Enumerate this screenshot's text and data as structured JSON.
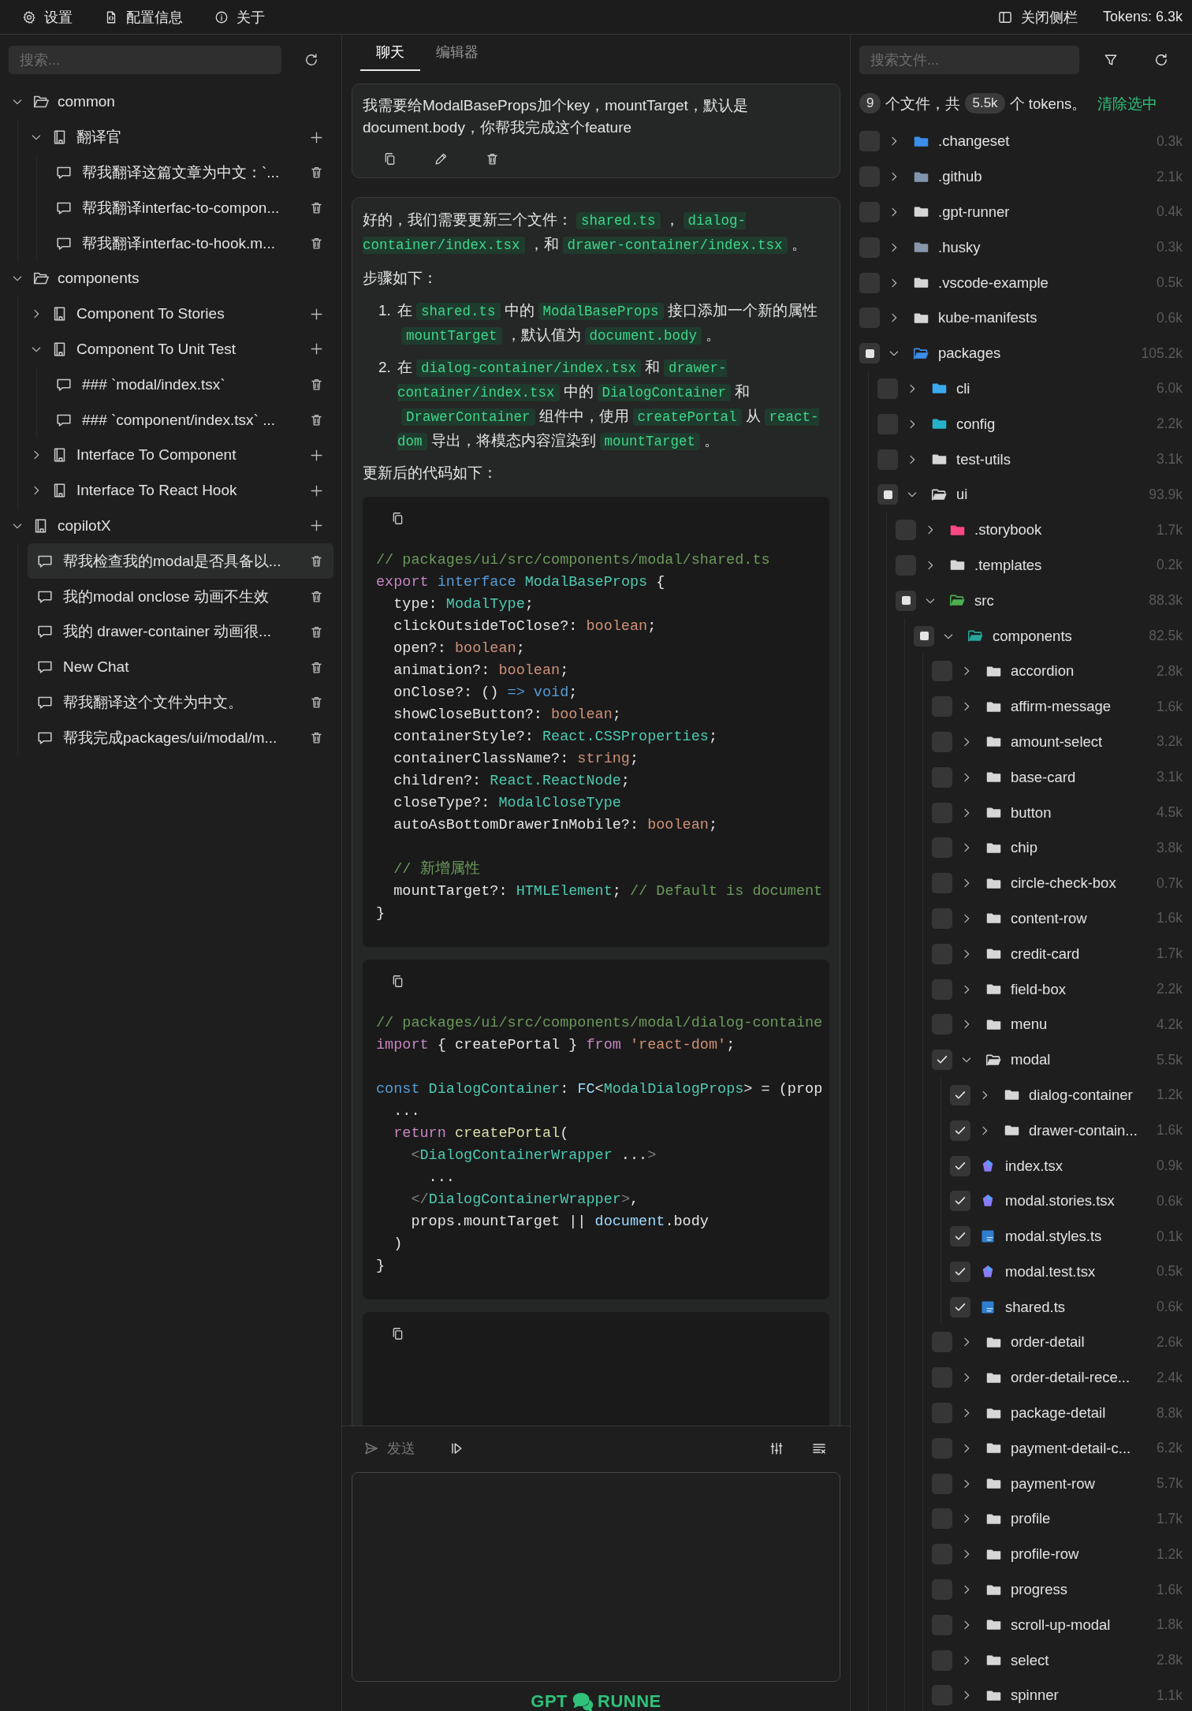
{
  "top_bar": {
    "items": [
      {
        "kind": "settings",
        "label": "设置"
      },
      {
        "kind": "config",
        "label": "配置信息"
      },
      {
        "kind": "about",
        "label": "关于"
      }
    ],
    "sidebar_toggle": "关闭侧栏",
    "tokens": "Tokens: 6.3k"
  },
  "sidebar": {
    "search": {
      "placeholder": "搜索..."
    },
    "tree": [
      {
        "kind": "folder",
        "label": "common",
        "expanded": true,
        "children": [
          {
            "kind": "prompt",
            "label": "翻译官",
            "expanded": true,
            "children": [
              {
                "kind": "chat",
                "label": "帮我翻译这篇文章为中文：`...",
                "selected": false
              },
              {
                "kind": "chat",
                "label": "帮我翻译interfac-to-compon...",
                "selected": false
              },
              {
                "kind": "chat",
                "label": "帮我翻译interfac-to-hook.m...",
                "selected": false
              }
            ]
          }
        ]
      },
      {
        "kind": "folder",
        "label": "components",
        "expanded": true,
        "children": [
          {
            "kind": "prompt",
            "label": "Component To Stories",
            "expanded": false
          },
          {
            "kind": "prompt",
            "label": "Component To Unit Test",
            "expanded": true,
            "children": [
              {
                "kind": "chat",
                "label": "### `modal/index.tsx`",
                "selected": false
              },
              {
                "kind": "chat",
                "label": "### `component/index.tsx` ...",
                "selected": false
              }
            ]
          },
          {
            "kind": "prompt",
            "label": "Interface To Component",
            "expanded": false
          },
          {
            "kind": "prompt",
            "label": "Interface To React Hook",
            "expanded": false
          }
        ]
      },
      {
        "kind": "prompt",
        "label": "copilotX",
        "expanded": true,
        "children": [
          {
            "kind": "chat",
            "label": "帮我检查我的modal是否具备以...",
            "selected": true
          },
          {
            "kind": "chat",
            "label": "我的modal onclose 动画不生效",
            "selected": false
          },
          {
            "kind": "chat",
            "label": "我的 drawer-container 动画很...",
            "selected": false
          },
          {
            "kind": "chat",
            "label": "New Chat",
            "selected": false
          },
          {
            "kind": "chat",
            "label": "帮我翻译这个文件为中文。",
            "selected": false
          },
          {
            "kind": "chat",
            "label": "帮我完成packages/ui/modal/m...",
            "selected": false
          }
        ]
      }
    ]
  },
  "chat": {
    "tabs": [
      {
        "label": "聊天",
        "selected": true
      },
      {
        "label": "编辑器",
        "selected": false
      }
    ],
    "messages": [
      {
        "kind": "user",
        "text": "我需要给ModalBaseProps加个key，mountTarget，默认是document.body，你帮我完成这个feature"
      },
      {
        "kind": "assistant",
        "blocks": [
          {
            "kind": "paragraph",
            "segments": [
              {
                "kind": "text",
                "text": "好的，我们需要更新三个文件："
              },
              {
                "kind": "code",
                "text": "shared.ts"
              },
              {
                "kind": "text",
                "text": "，"
              },
              {
                "kind": "code",
                "text": "dialog-container/index.tsx"
              },
              {
                "kind": "text",
                "text": "，和"
              },
              {
                "kind": "code",
                "text": "drawer-container/index.tsx"
              },
              {
                "kind": "text",
                "text": "。"
              }
            ]
          },
          {
            "kind": "paragraph",
            "segments": [
              {
                "kind": "text",
                "text": "步骤如下："
              }
            ]
          },
          {
            "kind": "list",
            "items": [
              {
                "number": "1.",
                "segments": [
                  {
                    "kind": "text",
                    "text": "在"
                  },
                  {
                    "kind": "code",
                    "text": "shared.ts"
                  },
                  {
                    "kind": "text",
                    "text": "中的"
                  },
                  {
                    "kind": "code",
                    "text": "ModalBaseProps"
                  },
                  {
                    "kind": "text",
                    "text": "接口添加一个新的属性"
                  },
                  {
                    "kind": "code",
                    "text": "mountTarget"
                  },
                  {
                    "kind": "text",
                    "text": "，默认值为"
                  },
                  {
                    "kind": "code",
                    "text": "document.body"
                  },
                  {
                    "kind": "text",
                    "text": "。"
                  }
                ]
              },
              {
                "number": "2.",
                "segments": [
                  {
                    "kind": "text",
                    "text": "在"
                  },
                  {
                    "kind": "code",
                    "text": "dialog-container/index.tsx"
                  },
                  {
                    "kind": "text",
                    "text": "和"
                  },
                  {
                    "kind": "code",
                    "text": "drawer-container/index.tsx"
                  },
                  {
                    "kind": "text",
                    "text": "中的"
                  },
                  {
                    "kind": "code",
                    "text": "DialogContainer"
                  },
                  {
                    "kind": "text",
                    "text": "和"
                  },
                  {
                    "kind": "code",
                    "text": "DrawerContainer"
                  },
                  {
                    "kind": "text",
                    "text": "组件中，使用"
                  },
                  {
                    "kind": "code",
                    "text": "createPortal"
                  },
                  {
                    "kind": "text",
                    "text": "从"
                  },
                  {
                    "kind": "code",
                    "text": "react-dom"
                  },
                  {
                    "kind": "text",
                    "text": "导出，将模态内容渲染到"
                  },
                  {
                    "kind": "code",
                    "text": "mountTarget"
                  },
                  {
                    "kind": "text",
                    "text": "。"
                  }
                ]
              }
            ]
          },
          {
            "kind": "paragraph",
            "segments": [
              {
                "kind": "text",
                "text": "更新后的代码如下："
              }
            ]
          },
          {
            "kind": "code",
            "lines": [
              {
                "kind": "code",
                "tokens": [
                  {
                    "kind": "comment",
                    "text": "// packages/ui/src/components/modal/shared.ts"
                  }
                ]
              },
              {
                "kind": "code",
                "tokens": [
                  {
                    "kind": "keyword",
                    "text": "export"
                  },
                  {
                    "kind": "storage",
                    "text": " interface"
                  },
                  {
                    "kind": "type",
                    "text": " ModalBaseProps"
                  },
                  {
                    "kind": "plain",
                    "text": " {"
                  }
                ]
              },
              {
                "kind": "code",
                "tokens": [
                  {
                    "kind": "plain",
                    "text": "  type: "
                  },
                  {
                    "kind": "type",
                    "text": "ModalType"
                  },
                  {
                    "kind": "plain",
                    "text": ";"
                  }
                ]
              },
              {
                "kind": "code",
                "tokens": [
                  {
                    "kind": "plain",
                    "text": "  clickOutsideToClose?: "
                  },
                  {
                    "kind": "literal",
                    "text": "boolean"
                  },
                  {
                    "kind": "plain",
                    "text": ";"
                  }
                ]
              },
              {
                "kind": "code",
                "tokens": [
                  {
                    "kind": "plain",
                    "text": "  open?: "
                  },
                  {
                    "kind": "literal",
                    "text": "boolean"
                  },
                  {
                    "kind": "plain",
                    "text": ";"
                  }
                ]
              },
              {
                "kind": "code",
                "tokens": [
                  {
                    "kind": "plain",
                    "text": "  animation?: "
                  },
                  {
                    "kind": "literal",
                    "text": "boolean"
                  },
                  {
                    "kind": "plain",
                    "text": ";"
                  }
                ]
              },
              {
                "kind": "code",
                "tokens": [
                  {
                    "kind": "plain",
                    "text": "  onClose?: () "
                  },
                  {
                    "kind": "storage",
                    "text": "=>"
                  },
                  {
                    "kind": "storage",
                    "text": " void"
                  },
                  {
                    "kind": "plain",
                    "text": ";"
                  }
                ]
              },
              {
                "kind": "code",
                "tokens": [
                  {
                    "kind": "plain",
                    "text": "  showCloseButton?: "
                  },
                  {
                    "kind": "literal",
                    "text": "boolean"
                  },
                  {
                    "kind": "plain",
                    "text": ";"
                  }
                ]
              },
              {
                "kind": "code",
                "tokens": [
                  {
                    "kind": "plain",
                    "text": "  containerStyle?: "
                  },
                  {
                    "kind": "type",
                    "text": "React.CSSProperties"
                  },
                  {
                    "kind": "plain",
                    "text": ";"
                  }
                ]
              },
              {
                "kind": "code",
                "tokens": [
                  {
                    "kind": "plain",
                    "text": "  containerClassName?: "
                  },
                  {
                    "kind": "literal",
                    "text": "string"
                  },
                  {
                    "kind": "plain",
                    "text": ";"
                  }
                ]
              },
              {
                "kind": "code",
                "tokens": [
                  {
                    "kind": "plain",
                    "text": "  children?: "
                  },
                  {
                    "kind": "type",
                    "text": "React.ReactNode"
                  },
                  {
                    "kind": "plain",
                    "text": ";"
                  }
                ]
              },
              {
                "kind": "code",
                "tokens": [
                  {
                    "kind": "plain",
                    "text": "  closeType?: "
                  },
                  {
                    "kind": "type",
                    "text": "ModalCloseType"
                  }
                ]
              },
              {
                "kind": "code",
                "tokens": [
                  {
                    "kind": "plain",
                    "text": "  autoAsBottomDrawerInMobile?: "
                  },
                  {
                    "kind": "literal",
                    "text": "boolean"
                  },
                  {
                    "kind": "plain",
                    "text": ";"
                  }
                ]
              },
              {
                "kind": "blank"
              },
              {
                "kind": "code",
                "tokens": [
                  {
                    "kind": "comment",
                    "text": "  // 新增属性"
                  }
                ]
              },
              {
                "kind": "code",
                "tokens": [
                  {
                    "kind": "plain",
                    "text": "  mountTarget?: "
                  },
                  {
                    "kind": "type",
                    "text": "HTMLElement"
                  },
                  {
                    "kind": "plain",
                    "text": "; "
                  },
                  {
                    "kind": "comment",
                    "text": "// Default is document"
                  }
                ]
              },
              {
                "kind": "code",
                "tokens": [
                  {
                    "kind": "plain",
                    "text": "}"
                  }
                ]
              }
            ]
          },
          {
            "kind": "code",
            "lines": [
              {
                "kind": "code",
                "tokens": [
                  {
                    "kind": "comment",
                    "text": "// packages/ui/src/components/modal/dialog-containe"
                  }
                ]
              },
              {
                "kind": "code",
                "tokens": [
                  {
                    "kind": "keyword",
                    "text": "import"
                  },
                  {
                    "kind": "plain",
                    "text": " { createPortal } "
                  },
                  {
                    "kind": "keyword",
                    "text": "from"
                  },
                  {
                    "kind": "literal",
                    "text": " 'react-dom'"
                  },
                  {
                    "kind": "plain",
                    "text": ";"
                  }
                ]
              },
              {
                "kind": "blank"
              },
              {
                "kind": "code",
                "tokens": [
                  {
                    "kind": "storage",
                    "text": "const"
                  },
                  {
                    "kind": "type",
                    "text": " DialogContainer"
                  },
                  {
                    "kind": "plain",
                    "text": ": "
                  },
                  {
                    "kind": "variable",
                    "text": "FC"
                  },
                  {
                    "kind": "plain",
                    "text": "<"
                  },
                  {
                    "kind": "type",
                    "text": "ModalDialogProps"
                  },
                  {
                    "kind": "plain",
                    "text": "> = (prop"
                  }
                ]
              },
              {
                "kind": "code",
                "tokens": [
                  {
                    "kind": "plain",
                    "text": "  ..."
                  }
                ]
              },
              {
                "kind": "code",
                "tokens": [
                  {
                    "kind": "keyword",
                    "text": "  return"
                  },
                  {
                    "kind": "function",
                    "text": " createPortal"
                  },
                  {
                    "kind": "plain",
                    "text": "("
                  }
                ]
              },
              {
                "kind": "code",
                "tokens": [
                  {
                    "kind": "punct",
                    "text": "    <"
                  },
                  {
                    "kind": "type",
                    "text": "DialogContainerWrapper"
                  },
                  {
                    "kind": "plain",
                    "text": " ..."
                  },
                  {
                    "kind": "punct",
                    "text": ">"
                  }
                ]
              },
              {
                "kind": "code",
                "tokens": [
                  {
                    "kind": "plain",
                    "text": "      ..."
                  }
                ]
              },
              {
                "kind": "code",
                "tokens": [
                  {
                    "kind": "punct",
                    "text": "    </"
                  },
                  {
                    "kind": "type",
                    "text": "DialogContainerWrapper"
                  },
                  {
                    "kind": "punct",
                    "text": ">"
                  },
                  {
                    "kind": "plain",
                    "text": ","
                  }
                ]
              },
              {
                "kind": "code",
                "tokens": [
                  {
                    "kind": "plain",
                    "text": "    props.mountTarget || "
                  },
                  {
                    "kind": "variable",
                    "text": "document"
                  },
                  {
                    "kind": "plain",
                    "text": ".body"
                  }
                ]
              },
              {
                "kind": "code",
                "tokens": [
                  {
                    "kind": "plain",
                    "text": "  )"
                  }
                ]
              },
              {
                "kind": "code",
                "tokens": [
                  {
                    "kind": "plain",
                    "text": "}"
                  }
                ]
              }
            ]
          },
          {
            "kind": "code"
          }
        ]
      }
    ],
    "send": {
      "label": "发送",
      "disabled": true
    },
    "logo": {
      "left": "GPT",
      "right": "RUNNE"
    }
  },
  "file_panel": {
    "search": {
      "placeholder": "搜索文件..."
    },
    "file_count": "9",
    "summary_1": "个文件，共",
    "token_count": "5.5k",
    "summary_2": "个 tokens。",
    "clear_link": "清除选中",
    "tree": [
      {
        "kind": "folder",
        "label": ".changeset",
        "size": "0.3k",
        "checked": false,
        "partial": false,
        "expanded": false,
        "color": "#3b8eea"
      },
      {
        "kind": "folder",
        "label": ".github",
        "size": "2.1k",
        "checked": false,
        "partial": false,
        "expanded": false,
        "color": "#7f96ad"
      },
      {
        "kind": "folder",
        "label": ".gpt-runner",
        "size": "0.4k",
        "checked": false,
        "partial": false,
        "expanded": false
      },
      {
        "kind": "folder",
        "label": ".husky",
        "size": "0.3k",
        "checked": false,
        "partial": false,
        "expanded": false,
        "color": "#8797ab"
      },
      {
        "kind": "folder",
        "label": ".vscode-example",
        "size": "0.5k",
        "checked": false,
        "partial": false,
        "expanded": false
      },
      {
        "kind": "folder",
        "label": "kube-manifests",
        "size": "0.6k",
        "checked": false,
        "partial": false,
        "expanded": false
      },
      {
        "kind": "folder",
        "label": "packages",
        "size": "105.2k",
        "checked": false,
        "partial": true,
        "expanded": true,
        "color": "#3b8eea",
        "children": [
          {
            "kind": "folder",
            "label": "cli",
            "size": "6.0k",
            "checked": false,
            "partial": false,
            "expanded": false,
            "color": "#3ba9f0"
          },
          {
            "kind": "folder",
            "label": "config",
            "size": "2.2k",
            "checked": false,
            "partial": false,
            "expanded": false,
            "color": "#26b3c9"
          },
          {
            "kind": "folder",
            "label": "test-utils",
            "size": "3.1k",
            "checked": false,
            "partial": false,
            "expanded": false
          },
          {
            "kind": "folder",
            "label": "ui",
            "size": "93.9k",
            "checked": false,
            "partial": true,
            "expanded": true,
            "children": [
              {
                "kind": "folder",
                "label": ".storybook",
                "size": "1.7k",
                "checked": false,
                "partial": false,
                "expanded": false,
                "color": "#ff4785"
              },
              {
                "kind": "folder",
                "label": ".templates",
                "size": "0.2k",
                "checked": false,
                "partial": false,
                "expanded": false
              },
              {
                "kind": "folder",
                "label": "src",
                "size": "88.3k",
                "checked": false,
                "partial": true,
                "expanded": true,
                "color": "#4caf50",
                "children": [
                  {
                    "kind": "folder",
                    "label": "components",
                    "size": "82.5k",
                    "checked": false,
                    "partial": true,
                    "expanded": true,
                    "color": "#26a69a",
                    "children": [
                      {
                        "kind": "folder",
                        "label": "accordion",
                        "size": "2.8k",
                        "checked": false,
                        "partial": false,
                        "expanded": false
                      },
                      {
                        "kind": "folder",
                        "label": "affirm-message",
                        "size": "1.6k",
                        "checked": false,
                        "partial": false,
                        "expanded": false
                      },
                      {
                        "kind": "folder",
                        "label": "amount-select",
                        "size": "3.2k",
                        "checked": false,
                        "partial": false,
                        "expanded": false
                      },
                      {
                        "kind": "folder",
                        "label": "base-card",
                        "size": "3.1k",
                        "checked": false,
                        "partial": false,
                        "expanded": false
                      },
                      {
                        "kind": "folder",
                        "label": "button",
                        "size": "4.5k",
                        "checked": false,
                        "partial": false,
                        "expanded": false
                      },
                      {
                        "kind": "folder",
                        "label": "chip",
                        "size": "3.8k",
                        "checked": false,
                        "partial": false,
                        "expanded": false
                      },
                      {
                        "kind": "folder",
                        "label": "circle-check-box",
                        "size": "0.7k",
                        "checked": false,
                        "partial": false,
                        "expanded": false
                      },
                      {
                        "kind": "folder",
                        "label": "content-row",
                        "size": "1.6k",
                        "checked": false,
                        "partial": false,
                        "expanded": false
                      },
                      {
                        "kind": "folder",
                        "label": "credit-card",
                        "size": "1.7k",
                        "checked": false,
                        "partial": false,
                        "expanded": false
                      },
                      {
                        "kind": "folder",
                        "label": "field-box",
                        "size": "2.2k",
                        "checked": false,
                        "partial": false,
                        "expanded": false
                      },
                      {
                        "kind": "folder",
                        "label": "menu",
                        "size": "4.2k",
                        "checked": false,
                        "partial": false,
                        "expanded": false
                      },
                      {
                        "kind": "folder",
                        "label": "modal",
                        "size": "5.5k",
                        "checked": true,
                        "partial": false,
                        "expanded": true,
                        "children": [
                          {
                            "kind": "folder",
                            "label": "dialog-container",
                            "size": "1.2k",
                            "checked": true,
                            "partial": false,
                            "expanded": false
                          },
                          {
                            "kind": "folder",
                            "label": "drawer-contain...",
                            "size": "1.6k",
                            "checked": true,
                            "partial": false,
                            "expanded": false
                          },
                          {
                            "kind": "tsx",
                            "label": "index.tsx",
                            "size": "0.9k",
                            "checked": true,
                            "partial": false
                          },
                          {
                            "kind": "tsx",
                            "label": "modal.stories.tsx",
                            "size": "0.6k",
                            "checked": true,
                            "partial": false
                          },
                          {
                            "kind": "ts",
                            "label": "modal.styles.ts",
                            "size": "0.1k",
                            "checked": true,
                            "partial": false
                          },
                          {
                            "kind": "tsx",
                            "label": "modal.test.tsx",
                            "size": "0.5k",
                            "checked": true,
                            "partial": false
                          },
                          {
                            "kind": "ts",
                            "label": "shared.ts",
                            "size": "0.6k",
                            "checked": true,
                            "partial": false
                          }
                        ]
                      },
                      {
                        "kind": "folder",
                        "label": "order-detail",
                        "size": "2.6k",
                        "checked": false,
                        "partial": false,
                        "expanded": false
                      },
                      {
                        "kind": "folder",
                        "label": "order-detail-rece...",
                        "size": "2.4k",
                        "checked": false,
                        "partial": false,
                        "expanded": false
                      },
                      {
                        "kind": "folder",
                        "label": "package-detail",
                        "size": "8.8k",
                        "checked": false,
                        "partial": false,
                        "expanded": false
                      },
                      {
                        "kind": "folder",
                        "label": "payment-detail-c...",
                        "size": "6.2k",
                        "checked": false,
                        "partial": false,
                        "expanded": false
                      },
                      {
                        "kind": "folder",
                        "label": "payment-row",
                        "size": "5.7k",
                        "checked": false,
                        "partial": false,
                        "expanded": false
                      },
                      {
                        "kind": "folder",
                        "label": "profile",
                        "size": "1.7k",
                        "checked": false,
                        "partial": false,
                        "expanded": false
                      },
                      {
                        "kind": "folder",
                        "label": "profile-row",
                        "size": "1.2k",
                        "checked": false,
                        "partial": false,
                        "expanded": false
                      },
                      {
                        "kind": "folder",
                        "label": "progress",
                        "size": "1.6k",
                        "checked": false,
                        "partial": false,
                        "expanded": false
                      },
                      {
                        "kind": "folder",
                        "label": "scroll-up-modal",
                        "size": "1.8k",
                        "checked": false,
                        "partial": false,
                        "expanded": false
                      },
                      {
                        "kind": "folder",
                        "label": "select",
                        "size": "2.8k",
                        "checked": false,
                        "partial": false,
                        "expanded": false
                      },
                      {
                        "kind": "folder",
                        "label": "spinner",
                        "size": "1.1k",
                        "checked": false,
                        "partial": false,
                        "expanded": false
                      }
                    ]
                  }
                ]
              }
            ]
          }
        ]
      }
    ]
  }
}
